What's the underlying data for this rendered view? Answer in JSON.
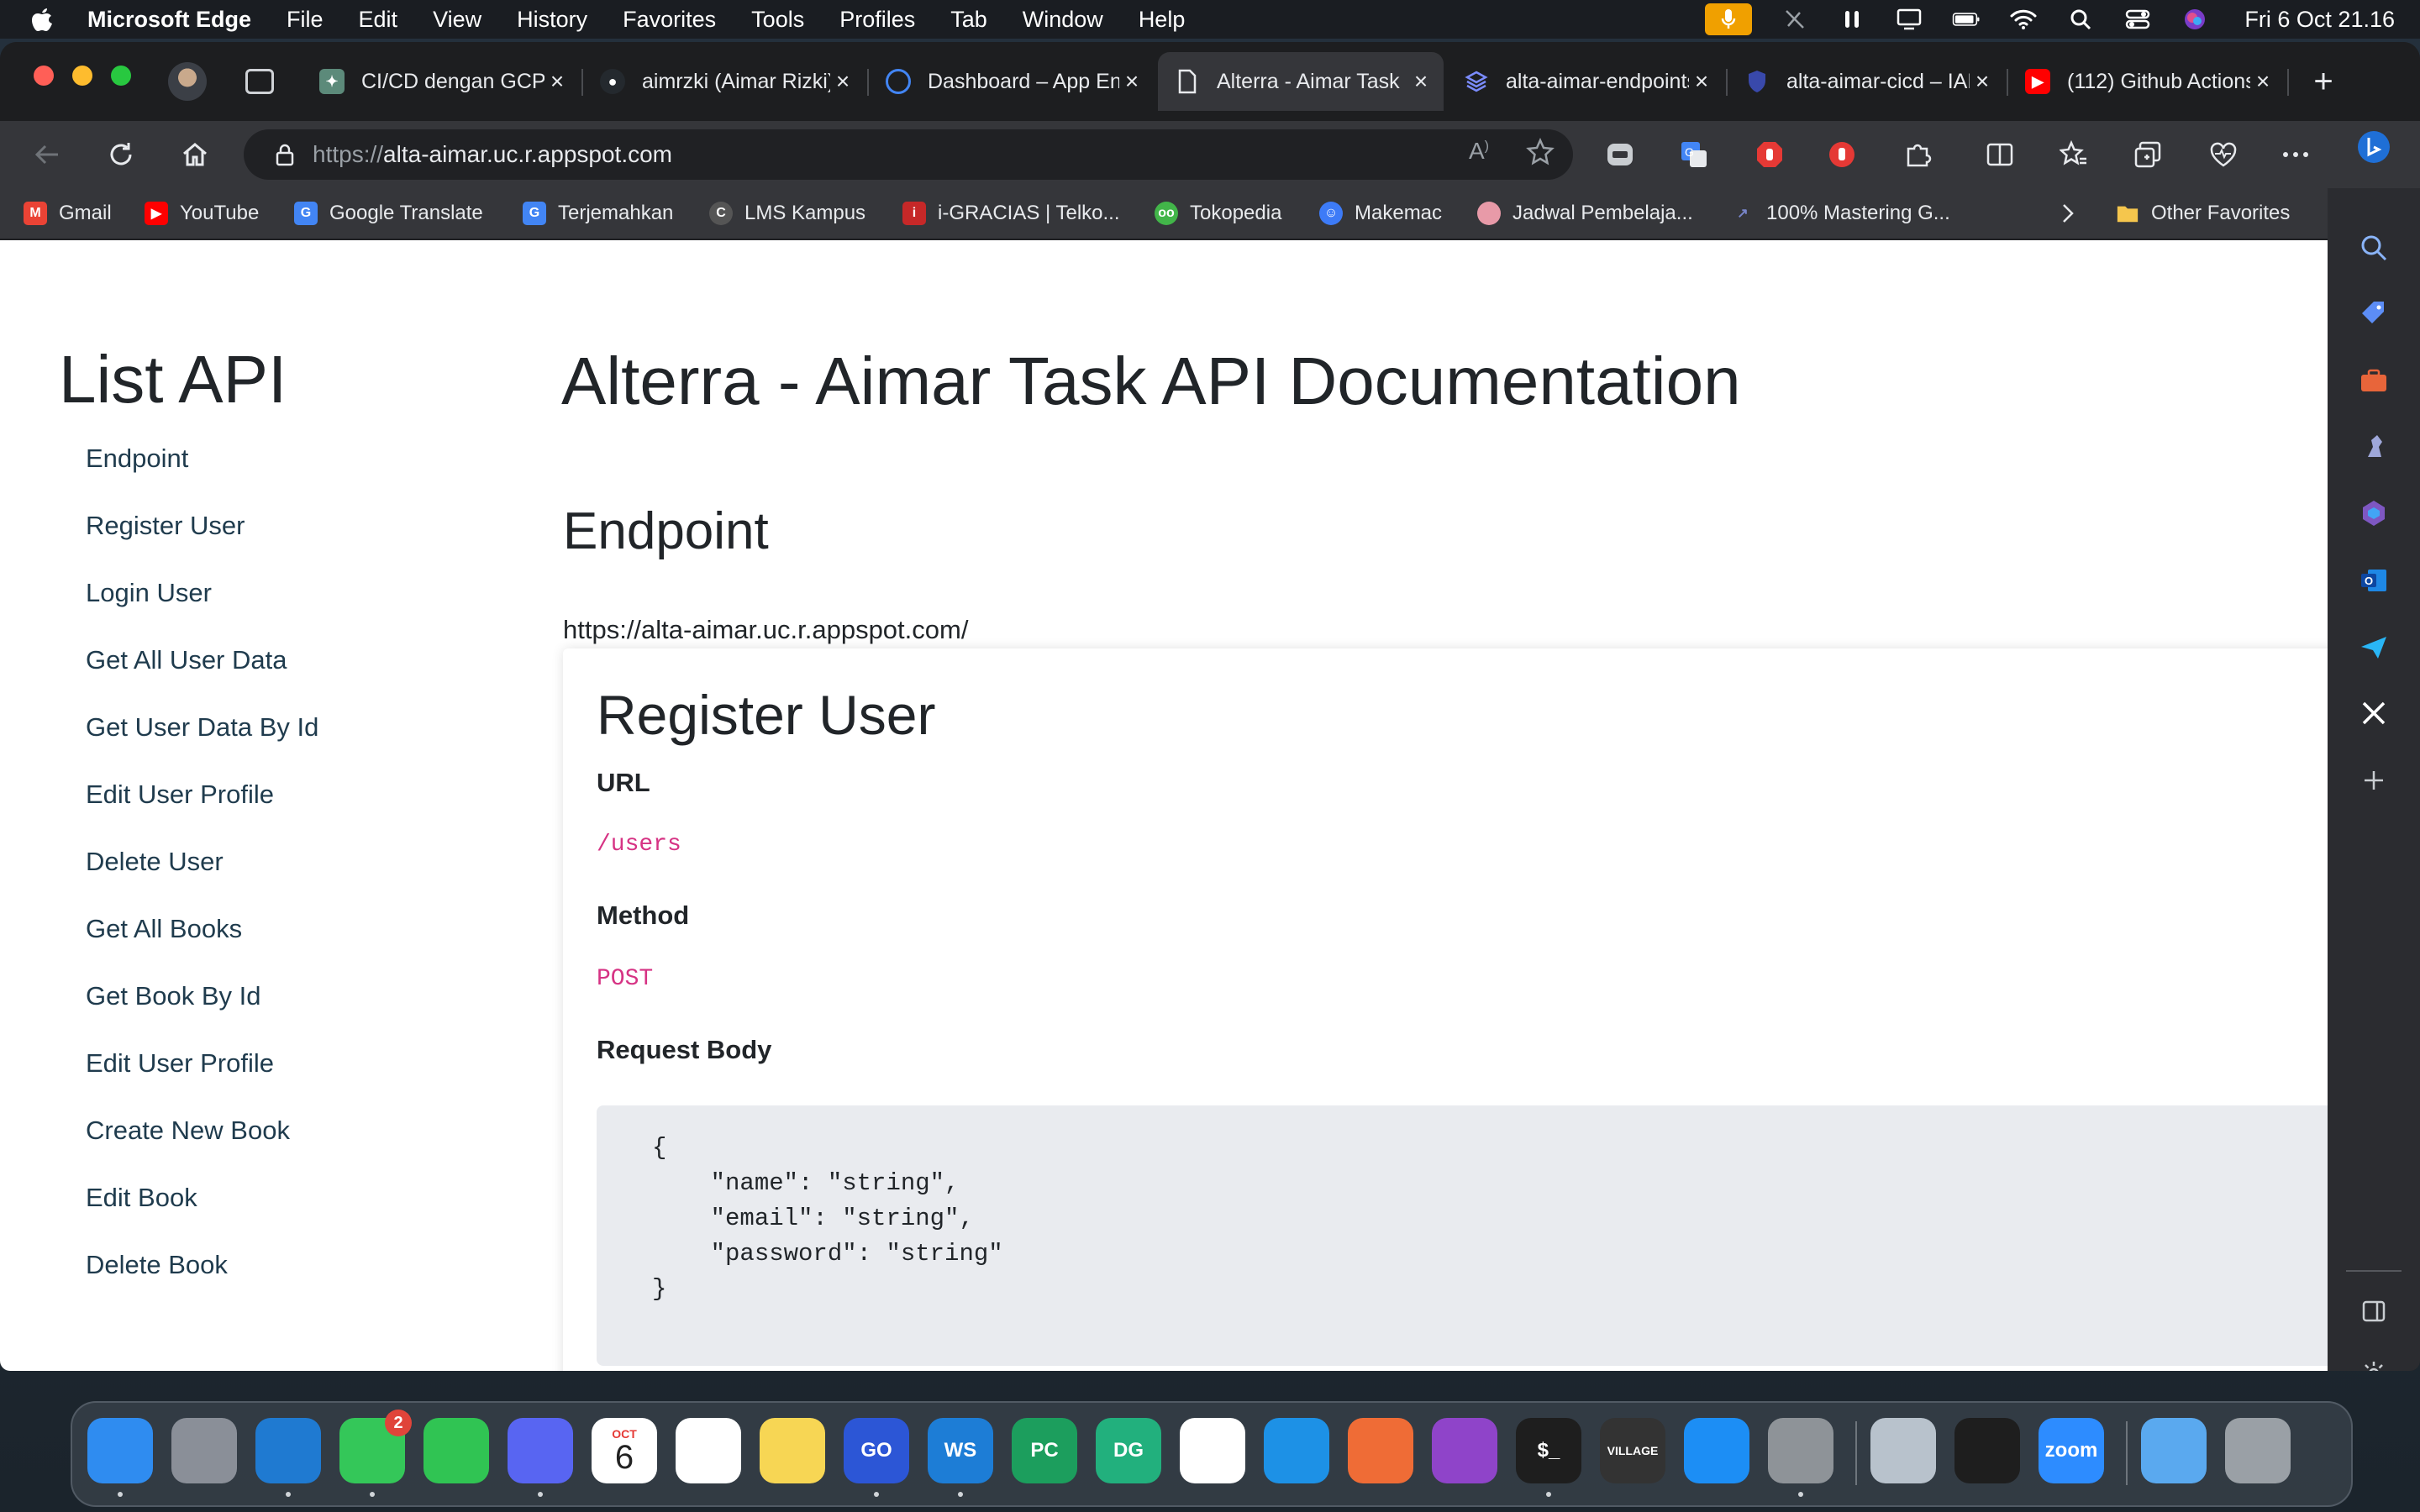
{
  "menubar": {
    "app_name": "Microsoft Edge",
    "items": [
      "File",
      "Edit",
      "View",
      "History",
      "Favorites",
      "Tools",
      "Profiles",
      "Tab",
      "Window",
      "Help"
    ],
    "clock": "Fri 6 Oct  21.16"
  },
  "tabs": [
    {
      "label": "CI/CD dengan GCP",
      "favicon": "chatgpt-icon",
      "color": "#5c8a7a"
    },
    {
      "label": "aimrzki (Aimar Rizki)",
      "favicon": "github-icon",
      "color": "#24292e"
    },
    {
      "label": "Dashboard – App Engine",
      "favicon": "app-engine-icon",
      "color": "#4285f4"
    },
    {
      "label": "Alterra - Aimar Task",
      "favicon": "document-icon",
      "color": "#5f6368",
      "active": true
    },
    {
      "label": "alta-aimar-endpoints",
      "favicon": "layers-icon",
      "color": "#3f51b5"
    },
    {
      "label": "alta-aimar-cicd – IAM",
      "favicon": "shield-icon",
      "color": "#3949ab"
    },
    {
      "label": "(112) Github Actions",
      "favicon": "youtube-icon",
      "color": "#ff0000"
    }
  ],
  "address": {
    "scheme": "https://",
    "host": "alta-aimar.uc.r.appspot.com"
  },
  "bookmarks": [
    {
      "label": "Gmail",
      "icon": "gmail-icon",
      "color": "#ea4335"
    },
    {
      "label": "YouTube",
      "icon": "youtube-icon",
      "color": "#ff0000"
    },
    {
      "label": "Google Translate",
      "icon": "google-translate-icon",
      "color": "#4285f4"
    },
    {
      "label": "Terjemahkan",
      "icon": "google-translate-icon",
      "color": "#4285f4"
    },
    {
      "label": "LMS Kampus",
      "icon": "lms-icon",
      "color": "#555555"
    },
    {
      "label": "i-GRACIAS | Telko...",
      "icon": "igracias-icon",
      "color": "#c62828"
    },
    {
      "label": "Tokopedia",
      "icon": "tokopedia-icon",
      "color": "#42b549"
    },
    {
      "label": "Makemac",
      "icon": "makemac-icon",
      "color": "#3d7bf7"
    },
    {
      "label": "Jadwal Pembelaja...",
      "icon": "brain-icon",
      "color": "#e89aa8"
    },
    {
      "label": "100% Mastering G...",
      "icon": "bookmark-icon",
      "color": "#3949ab"
    }
  ],
  "other_favorites": "Other Favorites",
  "page": {
    "sidebar_title": "List API",
    "nav": [
      "Endpoint",
      "Register User",
      "Login User",
      "Get All User Data",
      "Get User Data By Id",
      "Edit User Profile",
      "Delete User",
      "Get All Books",
      "Get Book By Id",
      "Edit User Profile",
      "Create New Book",
      "Edit Book",
      "Delete Book"
    ],
    "doc_title": "Alterra - Aimar Task API Documentation",
    "endpoint_heading": "Endpoint",
    "endpoint_url": "https://alta-aimar.uc.r.appspot.com/",
    "register": {
      "heading": "Register User",
      "url_label": "URL",
      "url_value": "/users",
      "method_label": "Method",
      "method_value": "POST",
      "body_label": "Request Body",
      "body_code": "{\n    \"name\": \"string\",\n    \"email\": \"string\",\n    \"password\": \"string\"\n}"
    }
  },
  "dock": [
    {
      "name": "finder-icon",
      "color": "#2f8cf0",
      "text": ""
    },
    {
      "name": "launchpad-icon",
      "color": "#8a8f98",
      "text": ""
    },
    {
      "name": "edge-icon",
      "color": "#1f7ad1",
      "text": ""
    },
    {
      "name": "messages-icon",
      "color": "#34c759",
      "text": "",
      "badge": "2"
    },
    {
      "name": "facetime-icon",
      "color": "#30c453",
      "text": ""
    },
    {
      "name": "discord-icon",
      "color": "#5865f2",
      "text": ""
    },
    {
      "name": "calendar-icon",
      "color": "#ffffff",
      "text": "6",
      "month": "OCT"
    },
    {
      "name": "reminders-icon",
      "color": "#ffffff",
      "text": ""
    },
    {
      "name": "notes-icon",
      "color": "#f7d654",
      "text": ""
    },
    {
      "name": "goland-icon",
      "color": "#2c56d6",
      "text": "GO"
    },
    {
      "name": "webstorm-icon",
      "color": "#1d7dd6",
      "text": "WS"
    },
    {
      "name": "pycharm-icon",
      "color": "#1c9e5d",
      "text": "PC"
    },
    {
      "name": "datagrip-icon",
      "color": "#22b07d",
      "text": "DG"
    },
    {
      "name": "vscode-icon",
      "color": "#ffffff",
      "text": ""
    },
    {
      "name": "docker-icon",
      "color": "#1d91e6",
      "text": ""
    },
    {
      "name": "postman-icon",
      "color": "#ef6c36",
      "text": ""
    },
    {
      "name": "github-desktop-icon",
      "color": "#8f44c9",
      "text": ""
    },
    {
      "name": "terminal-icon",
      "color": "#1e1e1e",
      "text": "$_"
    },
    {
      "name": "village-game-icon",
      "color": "#333333",
      "text": "VILLAGE"
    },
    {
      "name": "app-store-icon",
      "color": "#1c8ef5",
      "text": ""
    },
    {
      "name": "system-settings-icon",
      "color": "#8e9398",
      "text": ""
    },
    {
      "name": "network-settings-icon",
      "color": "#b8c2cc",
      "text": ""
    },
    {
      "name": "figma-icon",
      "color": "#1e1e1e",
      "text": ""
    },
    {
      "name": "zoom-icon",
      "color": "#2d8cff",
      "text": "zoom"
    },
    {
      "name": "folder-icon",
      "color": "#5aa9ef",
      "text": ""
    },
    {
      "name": "trash-icon",
      "color": "#9aa0a6",
      "text": ""
    }
  ]
}
